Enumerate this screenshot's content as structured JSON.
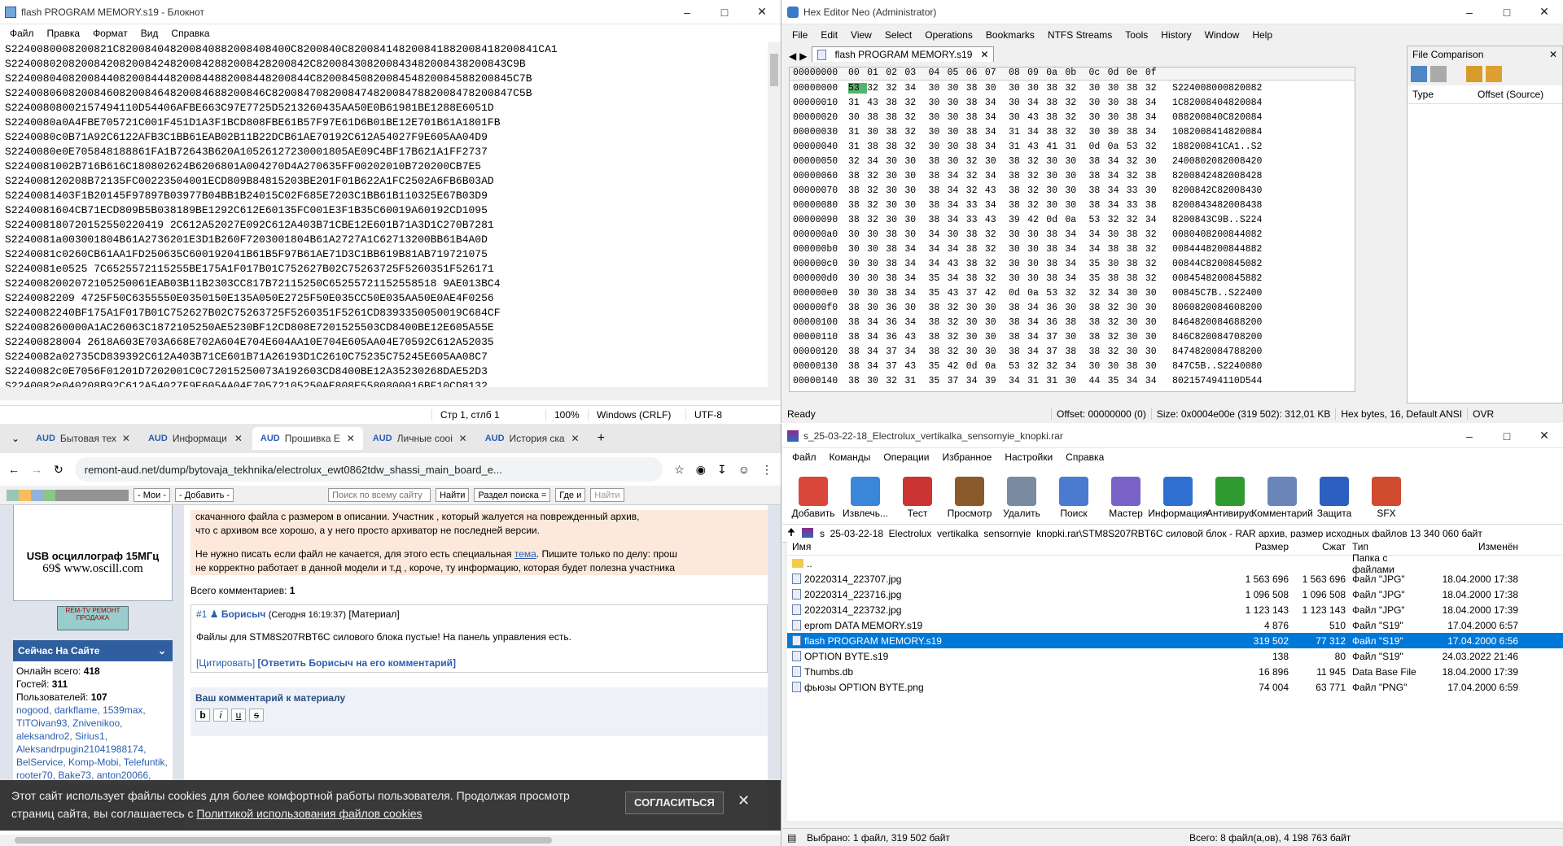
{
  "notepad": {
    "title": "flash PROGRAM MEMORY.s19 - Блокнот",
    "menu": [
      "Файл",
      "Правка",
      "Формат",
      "Вид",
      "Справка"
    ],
    "lines": [
      "S2240080008200821C820084048200840882008408400C8200840C820084148200841882008418200841CA1",
      "S22400802082008420820084248200842882008428200842C820084308200843482008438200843C9B",
      "S22400804082008440820084448200844882008448200844C8200845082008454820084588200845C7B",
      "S2240080608200846082008464820084688200846C82008470820084748200847882008478200847C5B",
      "S22400808002157494110D54406AFBE663C97E7725D5213260435AA50E0B61981BE1288E6051D",
      "S2240080a0A4FBE705721C001F451D1A3F1BCD808FBE61B57F97E61D6B01BE12E701B61A1801FB",
      "S2240080c0B71A92C6122AFB3C1BB61EAB02B11B22DCB61AE70192C612A54027F9E605AA04D9",
      "S2240080e0E705848188861FA1B72643B620A10526127230001805AE09C4BF17B621A1FF2737",
      "S2240081002B716B616C180802624B6206801A004270D4A270635FF00202010B720200CB7E5",
      "S224008120208B72135FC00223504001ECD809B84815203BE201F01B622A1FC2502A6FB6B03AD",
      "S2240081403F1B20145F97897B03977B04BB1B24015C02F685E7203C1BB61B110325E67B03D9",
      "S2240081604CB71ECD809B5B038189BE1292C612E60135FC001E3F1B35C60019A60192CD1095",
      "S224008180720152550220419 2C612A52027E092C612A403B71CBE12E601B71A3D1C270B7281",
      "S2240081a003001804B61A2736201E3D1B260F7203001804B61A2727A1C62713200BB61B4A0D",
      "S2240081c0260CB61AA1FD250635C600192041B61B5F97B61AE71D3C1BB619B81AB719721075",
      "S2240081e0525 7C6525572115255BE175A1F017B01C752627B02C75263725F5260351F526171",
      "S2240082002072105250061EAB03B11B2303CC817B72115250C65255721152558518 9AE013BC4",
      "S2240082209 4725F50C6355550E0350150E135A050E2725F50E035CC50E035AA50E0AE4F0256",
      "S2240082240BF175A1F017B01C752627B02C75263725F5260351F5261CD8393350050019C684CF",
      "S224008260000A1AC26063C1872105250AE5230BF12CD808E7201525503CD8400BE12E605A55E",
      "S22400828004 2618A603E703A668E702A604E704E604AA10E704E605AA04E70592C612A52035",
      "S2240082a02735CD839392C612A403B71CE601B71A26193D1C2610C75235C75245E605AA08C7",
      "S2240082c0E7056F01201D7202001C0C72015250073A192603CD8400BE12A35230268DAE52D3",
      "S2240082e040208B92C612A54027F9E605AA04E70572105250AE808E5580800016BF10CD8132"
    ],
    "status": {
      "pos": "Стр 1, стлб 1",
      "zoom": "100%",
      "eol": "Windows (CRLF)",
      "enc": "UTF-8"
    }
  },
  "hex": {
    "title": "Hex Editor Neo (Administrator)",
    "menu": [
      "File",
      "Edit",
      "View",
      "Select",
      "Operations",
      "Bookmarks",
      "NTFS Streams",
      "Tools",
      "History",
      "Window",
      "Help"
    ],
    "tab": "flash PROGRAM MEMORY.s19",
    "head_offset": "00000000",
    "head_cols": [
      "00",
      "01",
      "02",
      "03",
      "04",
      "05",
      "06",
      "07",
      "08",
      "09",
      "0a",
      "0b",
      "0c",
      "0d",
      "0e",
      "0f"
    ],
    "rows": [
      {
        "off": "00000000",
        "b": [
          "53",
          "32",
          "32",
          "34",
          "30",
          "30",
          "38",
          "30",
          "30",
          "30",
          "38",
          "32",
          "30",
          "30",
          "38",
          "32"
        ],
        "a": "S224008000820082"
      },
      {
        "off": "00000010",
        "b": [
          "31",
          "43",
          "38",
          "32",
          "30",
          "30",
          "38",
          "34",
          "30",
          "34",
          "38",
          "32",
          "30",
          "30",
          "38",
          "34"
        ],
        "a": "1C82008404820084"
      },
      {
        "off": "00000020",
        "b": [
          "30",
          "38",
          "38",
          "32",
          "30",
          "30",
          "38",
          "34",
          "30",
          "43",
          "38",
          "32",
          "30",
          "30",
          "38",
          "34"
        ],
        "a": "088200840C820084"
      },
      {
        "off": "00000030",
        "b": [
          "31",
          "30",
          "38",
          "32",
          "30",
          "30",
          "38",
          "34",
          "31",
          "34",
          "38",
          "32",
          "30",
          "30",
          "38",
          "34"
        ],
        "a": "1082008414820084"
      },
      {
        "off": "00000040",
        "b": [
          "31",
          "38",
          "38",
          "32",
          "30",
          "30",
          "38",
          "34",
          "31",
          "43",
          "41",
          "31",
          "0d",
          "0a",
          "53",
          "32"
        ],
        "a": "188200841CA1..S2"
      },
      {
        "off": "00000050",
        "b": [
          "32",
          "34",
          "30",
          "30",
          "38",
          "30",
          "32",
          "30",
          "38",
          "32",
          "30",
          "30",
          "38",
          "34",
          "32",
          "30"
        ],
        "a": "2400802082008420"
      },
      {
        "off": "00000060",
        "b": [
          "38",
          "32",
          "30",
          "30",
          "38",
          "34",
          "32",
          "34",
          "38",
          "32",
          "30",
          "30",
          "38",
          "34",
          "32",
          "38"
        ],
        "a": "8200842482008428"
      },
      {
        "off": "00000070",
        "b": [
          "38",
          "32",
          "30",
          "30",
          "38",
          "34",
          "32",
          "43",
          "38",
          "32",
          "30",
          "30",
          "38",
          "34",
          "33",
          "30"
        ],
        "a": "8200842C82008430"
      },
      {
        "off": "00000080",
        "b": [
          "38",
          "32",
          "30",
          "30",
          "38",
          "34",
          "33",
          "34",
          "38",
          "32",
          "30",
          "30",
          "38",
          "34",
          "33",
          "38"
        ],
        "a": "8200843482008438"
      },
      {
        "off": "00000090",
        "b": [
          "38",
          "32",
          "30",
          "30",
          "38",
          "34",
          "33",
          "43",
          "39",
          "42",
          "0d",
          "0a",
          "53",
          "32",
          "32",
          "34"
        ],
        "a": "8200843C9B..S224"
      },
      {
        "off": "000000a0",
        "b": [
          "30",
          "30",
          "38",
          "30",
          "34",
          "30",
          "38",
          "32",
          "30",
          "30",
          "38",
          "34",
          "34",
          "30",
          "38",
          "32"
        ],
        "a": "0080408200844082"
      },
      {
        "off": "000000b0",
        "b": [
          "30",
          "30",
          "38",
          "34",
          "34",
          "34",
          "38",
          "32",
          "30",
          "30",
          "38",
          "34",
          "34",
          "38",
          "38",
          "32"
        ],
        "a": "0084448200844882"
      },
      {
        "off": "000000c0",
        "b": [
          "30",
          "30",
          "38",
          "34",
          "34",
          "43",
          "38",
          "32",
          "30",
          "30",
          "38",
          "34",
          "35",
          "30",
          "38",
          "32"
        ],
        "a": "00844C8200845082"
      },
      {
        "off": "000000d0",
        "b": [
          "30",
          "30",
          "38",
          "34",
          "35",
          "34",
          "38",
          "32",
          "30",
          "30",
          "38",
          "34",
          "35",
          "38",
          "38",
          "32"
        ],
        "a": "0084548200845882"
      },
      {
        "off": "000000e0",
        "b": [
          "30",
          "30",
          "38",
          "34",
          "35",
          "43",
          "37",
          "42",
          "0d",
          "0a",
          "53",
          "32",
          "32",
          "34",
          "30",
          "30"
        ],
        "a": "00845C7B..S22400"
      },
      {
        "off": "000000f0",
        "b": [
          "38",
          "30",
          "36",
          "30",
          "38",
          "32",
          "30",
          "30",
          "38",
          "34",
          "36",
          "30",
          "38",
          "32",
          "30",
          "30"
        ],
        "a": "8060820084608200"
      },
      {
        "off": "00000100",
        "b": [
          "38",
          "34",
          "36",
          "34",
          "38",
          "32",
          "30",
          "30",
          "38",
          "34",
          "36",
          "38",
          "38",
          "32",
          "30",
          "30"
        ],
        "a": "8464820084688200"
      },
      {
        "off": "00000110",
        "b": [
          "38",
          "34",
          "36",
          "43",
          "38",
          "32",
          "30",
          "30",
          "38",
          "34",
          "37",
          "30",
          "38",
          "32",
          "30",
          "30"
        ],
        "a": "846C820084708200"
      },
      {
        "off": "00000120",
        "b": [
          "38",
          "34",
          "37",
          "34",
          "38",
          "32",
          "30",
          "30",
          "38",
          "34",
          "37",
          "38",
          "38",
          "32",
          "30",
          "30"
        ],
        "a": "8474820084788200"
      },
      {
        "off": "00000130",
        "b": [
          "38",
          "34",
          "37",
          "43",
          "35",
          "42",
          "0d",
          "0a",
          "53",
          "32",
          "32",
          "34",
          "30",
          "30",
          "38",
          "30"
        ],
        "a": "847C5B..S2240080"
      },
      {
        "off": "00000140",
        "b": [
          "38",
          "30",
          "32",
          "31",
          "35",
          "37",
          "34",
          "39",
          "34",
          "31",
          "31",
          "30",
          "44",
          "35",
          "34",
          "34"
        ],
        "a": "802157494110D544"
      }
    ],
    "fc": {
      "title": "File Comparison",
      "col1": "Type",
      "col2": "Offset (Source)"
    },
    "status": {
      "ready": "Ready",
      "offset": "Offset: 00000000 (0)",
      "size": "Size: 0x0004e00e (319 502): 312,01 KB",
      "mode": "Hex bytes, 16, Default ANSI",
      "ovr": "OVR"
    }
  },
  "browser": {
    "tabs": [
      "Бытовая тех",
      "Информаци",
      "Прошивка E",
      "Личные сооі",
      "История ска"
    ],
    "url": "remont-aud.net/dump/bytovaja_tekhnika/electrolux_ewt0862tdw_shassi_main_board_e...",
    "ubar": {
      "mine": "- Мои -",
      "add": "- Добавить -",
      "search_ph": "Поиск по всему сайту",
      "find": "Найти",
      "section": "Раздел поиска =",
      "where": "Где и",
      "find2": "Найти"
    },
    "side": {
      "banner1": "USB осциллограф 15МГц",
      "banner2": "69$  www.oscill.com",
      "rem": "REM-TV РЕМОНТ ПРОДАЖА",
      "now_title": "Сейчас На Сайте",
      "online_label": "Онлайн всего:",
      "online": "418",
      "guests_label": "Гостей:",
      "guests": "311",
      "users_label": "Пользователей:",
      "users": "107",
      "names": "nogood, darkflame, 1539max, TITOivan93, Znivenikoo, aleksandro2, Sirius1, Aleksandrpugin21041988174, BelService, Komp-Mobi, Telefuntik, rooter70, Bake73, anton20066,"
    },
    "main": {
      "p1": "скачанного файла с размером в описании. Участник , который жалуется на поврежденный архив,",
      "p2": "что с архивом все хорошо, а у него просто архиватор не последней версии.",
      "p3a": "Не нужно писать если файл не качается, для этого есть специальная",
      "p3link": "тема",
      "p3b": ". Пишите только по делу: прош",
      "p4": "не корректно работает в данной модели и т.д , короче, ту информацию, которая будет полезна участника",
      "comments_label": "Всего комментариев:",
      "comments": "1",
      "num": "#1",
      "author": "Борисыч",
      "when": "(Сегодня 16:19:37)",
      "mat": "[Материал]",
      "text": "Файлы для STM8S207RBT6C силового блока пустые! На панель управления есть.",
      "quote": "[Цитировать]",
      "reply": "[Ответить Борисыч на его комментарий]",
      "form_title": "Ваш комментарий к материалу"
    },
    "cookie": {
      "text1": "Этот сайт использует файлы cookies для более комфортной работы пользователя. Продолжая просмотр",
      "text2": "страниц сайта, вы соглашаетесь с",
      "link": "Политикой использования файлов cookies",
      "agree": "СОГЛАСИТЬСЯ"
    }
  },
  "winrar": {
    "title": "s_25-03-22-18_Electrolux_vertikalka_sensornyie_knopki.rar",
    "menu": [
      "Файл",
      "Команды",
      "Операции",
      "Избранное",
      "Настройки",
      "Справка"
    ],
    "tools": [
      {
        "label": "Добавить",
        "color": "#d9473a"
      },
      {
        "label": "Извлечь...",
        "color": "#3a86d9"
      },
      {
        "label": "Тест",
        "color": "#c33"
      },
      {
        "label": "Просмотр",
        "color": "#8b5a2b"
      },
      {
        "label": "Удалить",
        "color": "#7a8aa0"
      },
      {
        "label": "Поиск",
        "color": "#4a7bd0"
      },
      {
        "label": "Мастер",
        "color": "#7a63c8"
      },
      {
        "label": "Информация",
        "color": "#2f6fd0"
      },
      {
        "label": "Антивирус",
        "color": "#2f9a2f"
      },
      {
        "label": "Комментарий",
        "color": "#6a86b8"
      },
      {
        "label": "Защита",
        "color": "#2d5fc0"
      },
      {
        "label": "SFX",
        "color": "#d04a2f"
      }
    ],
    "path": "s_25-03-22-18_Electrolux_vertikalka_sensornyie_knopki.rar\\STM8S207RBT6C силовой блок - RAR архив, размер исходных файлов 13 340 060 байт",
    "cols": [
      "Имя",
      "Размер",
      "Сжат",
      "Тип",
      "Изменён"
    ],
    "rows": [
      {
        "name": "..",
        "size": "",
        "packed": "",
        "type": "Папка с файлами",
        "mod": "",
        "folder": true
      },
      {
        "name": "20220314_223707.jpg",
        "size": "1 563 696",
        "packed": "1 563 696",
        "type": "Файл \"JPG\"",
        "mod": "18.04.2000 17:38"
      },
      {
        "name": "20220314_223716.jpg",
        "size": "1 096 508",
        "packed": "1 096 508",
        "type": "Файл \"JPG\"",
        "mod": "18.04.2000 17:38"
      },
      {
        "name": "20220314_223732.jpg",
        "size": "1 123 143",
        "packed": "1 123 143",
        "type": "Файл \"JPG\"",
        "mod": "18.04.2000 17:39"
      },
      {
        "name": "eprom DATA MEMORY.s19",
        "size": "4 876",
        "packed": "510",
        "type": "Файл \"S19\"",
        "mod": "17.04.2000 6:57"
      },
      {
        "name": "flash PROGRAM MEMORY.s19",
        "size": "319 502",
        "packed": "77 312",
        "type": "Файл \"S19\"",
        "mod": "17.04.2000 6:56",
        "selected": true
      },
      {
        "name": "OPTION BYTE.s19",
        "size": "138",
        "packed": "80",
        "type": "Файл \"S19\"",
        "mod": "24.03.2022 21:46"
      },
      {
        "name": "Thumbs.db",
        "size": "16 896",
        "packed": "11 945",
        "type": "Data Base File",
        "mod": "18.04.2000 17:39"
      },
      {
        "name": "фьюзы OPTION BYTE.png",
        "size": "74 004",
        "packed": "63 771",
        "type": "Файл \"PNG\"",
        "mod": "17.04.2000 6:59"
      }
    ],
    "status": {
      "left": "Выбрано: 1 файл, 319 502 байт",
      "right": "Всего: 8 файл(а,ов), 4 198 763 байт"
    }
  },
  "colors": {
    "accent": "#0078d7",
    "hexbg": "#ffffff",
    "sel_byte": "#55b36b",
    "sidebar_head": "#2f5f9e"
  }
}
